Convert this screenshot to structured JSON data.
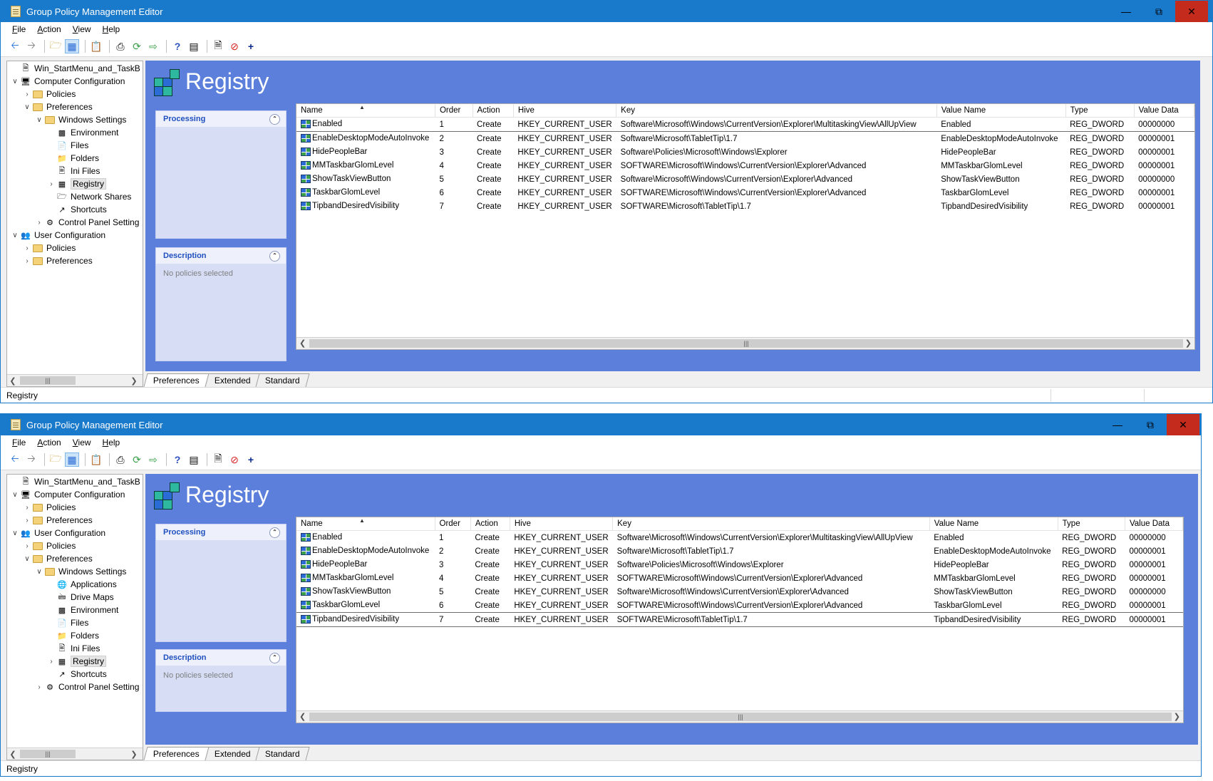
{
  "windows": [
    {
      "title": "Group Policy Management Editor",
      "menu": [
        "File",
        "Action",
        "View",
        "Help"
      ],
      "tree": [
        {
          "label": "Win_StartMenu_and_TaskB",
          "level": 0,
          "exp": "",
          "icon": "gpo"
        },
        {
          "label": "Computer Configuration",
          "level": 0,
          "exp": "v",
          "icon": "computer"
        },
        {
          "label": "Policies",
          "level": 1,
          "exp": ">",
          "icon": "folder"
        },
        {
          "label": "Preferences",
          "level": 1,
          "exp": "v",
          "icon": "folder"
        },
        {
          "label": "Windows Settings",
          "level": 2,
          "exp": "v",
          "icon": "folder"
        },
        {
          "label": "Environment",
          "level": 3,
          "exp": "",
          "icon": "environment"
        },
        {
          "label": "Files",
          "level": 3,
          "exp": "",
          "icon": "files"
        },
        {
          "label": "Folders",
          "level": 3,
          "exp": "",
          "icon": "folders"
        },
        {
          "label": "Ini Files",
          "level": 3,
          "exp": "",
          "icon": "ini"
        },
        {
          "label": "Registry",
          "level": 3,
          "exp": ">",
          "icon": "registry",
          "selected": true
        },
        {
          "label": "Network Shares",
          "level": 3,
          "exp": "",
          "icon": "share"
        },
        {
          "label": "Shortcuts",
          "level": 3,
          "exp": "",
          "icon": "shortcut"
        },
        {
          "label": "Control Panel Setting",
          "level": 2,
          "exp": ">",
          "icon": "control-panel"
        },
        {
          "label": "User Configuration",
          "level": 0,
          "exp": "v",
          "icon": "user"
        },
        {
          "label": "Policies",
          "level": 1,
          "exp": ">",
          "icon": "folder"
        },
        {
          "label": "Preferences",
          "level": 1,
          "exp": ">",
          "icon": "folder"
        }
      ],
      "focused_row": 0,
      "status": "Registry"
    },
    {
      "title": "Group Policy Management Editor",
      "menu": [
        "File",
        "Action",
        "View",
        "Help"
      ],
      "tree": [
        {
          "label": "Win_StartMenu_and_TaskB",
          "level": 0,
          "exp": "",
          "icon": "gpo"
        },
        {
          "label": "Computer Configuration",
          "level": 0,
          "exp": "v",
          "icon": "computer"
        },
        {
          "label": "Policies",
          "level": 1,
          "exp": ">",
          "icon": "folder"
        },
        {
          "label": "Preferences",
          "level": 1,
          "exp": ">",
          "icon": "folder"
        },
        {
          "label": "User Configuration",
          "level": 0,
          "exp": "v",
          "icon": "user"
        },
        {
          "label": "Policies",
          "level": 1,
          "exp": ">",
          "icon": "folder"
        },
        {
          "label": "Preferences",
          "level": 1,
          "exp": "v",
          "icon": "folder"
        },
        {
          "label": "Windows Settings",
          "level": 2,
          "exp": "v",
          "icon": "folder"
        },
        {
          "label": "Applications",
          "level": 3,
          "exp": "",
          "icon": "applications"
        },
        {
          "label": "Drive Maps",
          "level": 3,
          "exp": "",
          "icon": "drive"
        },
        {
          "label": "Environment",
          "level": 3,
          "exp": "",
          "icon": "environment"
        },
        {
          "label": "Files",
          "level": 3,
          "exp": "",
          "icon": "files"
        },
        {
          "label": "Folders",
          "level": 3,
          "exp": "",
          "icon": "folders"
        },
        {
          "label": "Ini Files",
          "level": 3,
          "exp": "",
          "icon": "ini"
        },
        {
          "label": "Registry",
          "level": 3,
          "exp": ">",
          "icon": "registry",
          "selected": true
        },
        {
          "label": "Shortcuts",
          "level": 3,
          "exp": "",
          "icon": "shortcut"
        },
        {
          "label": "Control Panel Setting",
          "level": 2,
          "exp": ">",
          "icon": "control-panel"
        }
      ],
      "focused_row": 6,
      "status": "Registry"
    }
  ],
  "registry_title": "Registry",
  "processing_label": "Processing",
  "description_label": "Description",
  "description_text": "No policies selected",
  "columns": [
    "Name",
    "Order",
    "Action",
    "Hive",
    "Key",
    "Value Name",
    "Type",
    "Value Data"
  ],
  "rows": [
    [
      "Enabled",
      "1",
      "Create",
      "HKEY_CURRENT_USER",
      "Software\\Microsoft\\Windows\\CurrentVersion\\Explorer\\MultitaskingView\\AllUpView",
      "Enabled",
      "REG_DWORD",
      "00000000"
    ],
    [
      "EnableDesktopModeAutoInvoke",
      "2",
      "Create",
      "HKEY_CURRENT_USER",
      "Software\\Microsoft\\TabletTip\\1.7",
      "EnableDesktopModeAutoInvoke",
      "REG_DWORD",
      "00000001"
    ],
    [
      "HidePeopleBar",
      "3",
      "Create",
      "HKEY_CURRENT_USER",
      "Software\\Policies\\Microsoft\\Windows\\Explorer",
      "HidePeopleBar",
      "REG_DWORD",
      "00000001"
    ],
    [
      "MMTaskbarGlomLevel",
      "4",
      "Create",
      "HKEY_CURRENT_USER",
      "SOFTWARE\\Microsoft\\Windows\\CurrentVersion\\Explorer\\Advanced",
      "MMTaskbarGlomLevel",
      "REG_DWORD",
      "00000001"
    ],
    [
      "ShowTaskViewButton",
      "5",
      "Create",
      "HKEY_CURRENT_USER",
      "Software\\Microsoft\\Windows\\CurrentVersion\\Explorer\\Advanced",
      "ShowTaskViewButton",
      "REG_DWORD",
      "00000000"
    ],
    [
      "TaskbarGlomLevel",
      "6",
      "Create",
      "HKEY_CURRENT_USER",
      "SOFTWARE\\Microsoft\\Windows\\CurrentVersion\\Explorer\\Advanced",
      "TaskbarGlomLevel",
      "REG_DWORD",
      "00000001"
    ],
    [
      "TipbandDesiredVisibility",
      "7",
      "Create",
      "HKEY_CURRENT_USER",
      "SOFTWARE\\Microsoft\\TabletTip\\1.7",
      "TipbandDesiredVisibility",
      "REG_DWORD",
      "00000001"
    ]
  ],
  "tabs": [
    "Preferences",
    "Extended",
    "Standard"
  ],
  "active_tab": "Preferences",
  "colors": {
    "titlebar": "#1979ca",
    "pane_background": "#5b7fdb",
    "close_button": "#c42b1c"
  }
}
